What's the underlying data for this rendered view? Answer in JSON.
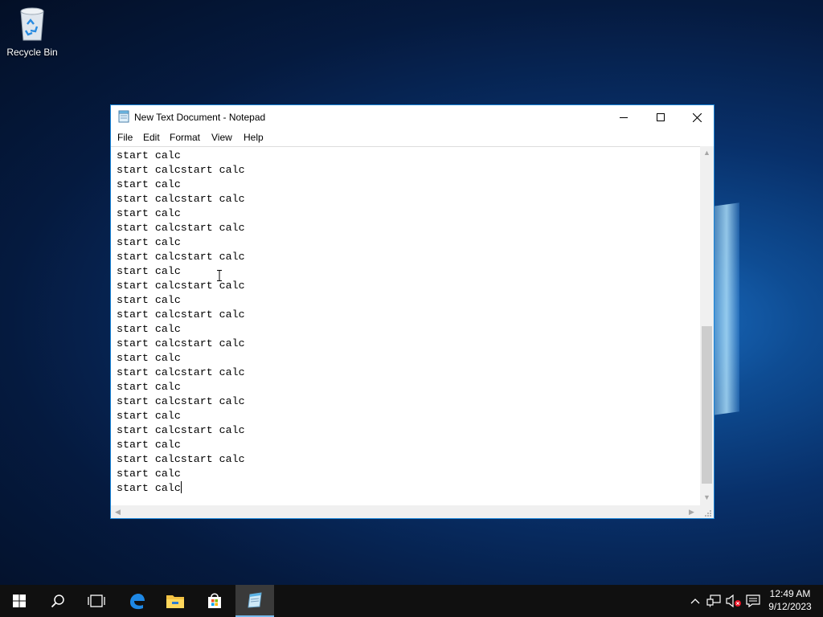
{
  "desktop": {
    "icons": [
      {
        "label": "Recycle Bin",
        "icon": "recycle-bin-icon"
      }
    ]
  },
  "window": {
    "title": "New Text Document - Notepad",
    "menu": [
      "File",
      "Edit",
      "Format",
      "View",
      "Help"
    ],
    "lines": [
      "start calc",
      "start calcstart calc",
      "start calc",
      "start calcstart calc",
      "start calc",
      "start calcstart calc",
      "start calc",
      "start calcstart calc",
      "start calc",
      "start calcstart calc",
      "start calc",
      "start calcstart calc",
      "start calc",
      "start calcstart calc",
      "start calc",
      "start calcstart calc",
      "start calc",
      "start calcstart calc",
      "start calc",
      "start calcstart calc",
      "start calc",
      "start calcstart calc",
      "start calc",
      "start calc"
    ]
  },
  "taskbar": {
    "buttons": [
      "start-icon",
      "search-icon",
      "task-view-icon",
      "edge-icon",
      "file-explorer-icon",
      "store-icon",
      "notepad-icon"
    ],
    "tray": [
      "chevron-up-icon",
      "network-icon",
      "volume-muted-icon",
      "notification-icon"
    ],
    "time": "12:49 AM",
    "date": "9/12/2023"
  },
  "colors": {
    "accent": "#1883d7",
    "taskbar": "#101010"
  }
}
